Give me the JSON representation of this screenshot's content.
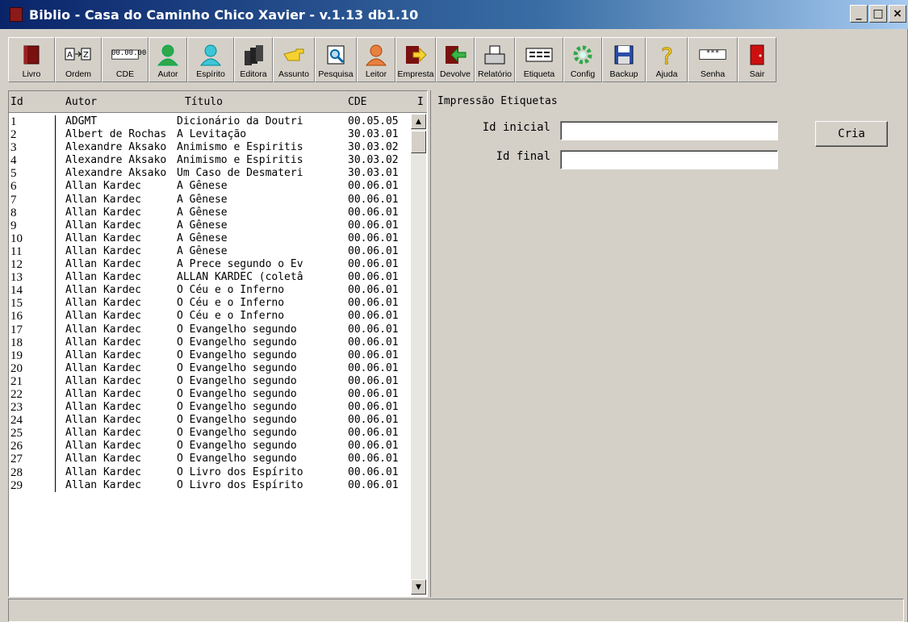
{
  "window": {
    "title": "Biblio - Casa do Caminho Chico Xavier - v.1.13 db1.10",
    "controls": {
      "minimize": "_",
      "maximize": "□",
      "close": "×"
    }
  },
  "toolbar": [
    {
      "label": "Livro",
      "icon": "book-icon",
      "width": 58
    },
    {
      "label": "Ordem",
      "icon": "sort-az-icon",
      "width": 58
    },
    {
      "label": "CDE",
      "icon": "cde-code-icon",
      "width": 58,
      "code": "00.00.00"
    },
    {
      "label": "Autor",
      "icon": "author-person-icon",
      "width": 48
    },
    {
      "label": "Espírito",
      "icon": "spirit-person-icon",
      "width": 58
    },
    {
      "label": "Editora",
      "icon": "books-stack-icon",
      "width": 48
    },
    {
      "label": "Assunto",
      "icon": "pointing-hand-icon",
      "width": 52
    },
    {
      "label": "Pesquisa",
      "icon": "search-icon",
      "width": 52
    },
    {
      "label": "Leitor",
      "icon": "reader-person-icon",
      "width": 48
    },
    {
      "label": "Empresta",
      "icon": "lend-arrow-icon",
      "width": 50
    },
    {
      "label": "Devolve",
      "icon": "return-arrow-icon",
      "width": 48
    },
    {
      "label": "Relatório",
      "icon": "printer-icon",
      "width": 50
    },
    {
      "label": "Etiqueta",
      "icon": "label-icon",
      "width": 60
    },
    {
      "label": "Config",
      "icon": "gear-icon",
      "width": 48
    },
    {
      "label": "Backup",
      "icon": "floppy-disk-icon",
      "width": 54
    },
    {
      "label": "Ajuda",
      "icon": "help-icon",
      "width": 52
    },
    {
      "label": "Senha",
      "icon": "password-icon",
      "width": 62,
      "code": "***"
    },
    {
      "label": "Sair",
      "icon": "exit-door-icon",
      "width": 48
    }
  ],
  "list": {
    "columns": [
      "Id",
      "Autor",
      "Título",
      "CDE",
      "I"
    ],
    "rows": [
      {
        "id": "1",
        "autor": "ADGMT",
        "titulo": "Dicionário da Doutri",
        "cde": "00.05.05"
      },
      {
        "id": "2",
        "autor": "Albert de Rochas",
        "titulo": "A Levitação",
        "cde": "30.03.01"
      },
      {
        "id": "3",
        "autor": "Alexandre Aksako",
        "titulo": "Animismo e Espiritis",
        "cde": "30.03.02"
      },
      {
        "id": "4",
        "autor": "Alexandre Aksako",
        "titulo": "Animismo e Espiritis",
        "cde": "30.03.02"
      },
      {
        "id": "5",
        "autor": "Alexandre Aksako",
        "titulo": "Um Caso de Desmateri",
        "cde": "30.03.01"
      },
      {
        "id": "6",
        "autor": "Allan Kardec",
        "titulo": "A Gênese",
        "cde": "00.06.01"
      },
      {
        "id": "7",
        "autor": "Allan Kardec",
        "titulo": "A Gênese",
        "cde": "00.06.01"
      },
      {
        "id": "8",
        "autor": "Allan Kardec",
        "titulo": "A Gênese",
        "cde": "00.06.01"
      },
      {
        "id": "9",
        "autor": "Allan Kardec",
        "titulo": "A Gênese",
        "cde": "00.06.01"
      },
      {
        "id": "10",
        "autor": "Allan Kardec",
        "titulo": "A Gênese",
        "cde": "00.06.01"
      },
      {
        "id": "11",
        "autor": "Allan Kardec",
        "titulo": "A Gênese",
        "cde": "00.06.01"
      },
      {
        "id": "12",
        "autor": "Allan Kardec",
        "titulo": "A Prece segundo o Ev",
        "cde": "00.06.01"
      },
      {
        "id": "13",
        "autor": "Allan Kardec",
        "titulo": "ALLAN KARDEC (coletâ",
        "cde": "00.06.01"
      },
      {
        "id": "14",
        "autor": "Allan Kardec",
        "titulo": "O Céu e o Inferno",
        "cde": "00.06.01"
      },
      {
        "id": "15",
        "autor": "Allan Kardec",
        "titulo": "O Céu e o Inferno",
        "cde": "00.06.01"
      },
      {
        "id": "16",
        "autor": "Allan Kardec",
        "titulo": "O Céu e o Inferno",
        "cde": "00.06.01"
      },
      {
        "id": "17",
        "autor": "Allan Kardec",
        "titulo": "O Evangelho segundo",
        "cde": "00.06.01"
      },
      {
        "id": "18",
        "autor": "Allan Kardec",
        "titulo": "O Evangelho segundo",
        "cde": "00.06.01"
      },
      {
        "id": "19",
        "autor": "Allan Kardec",
        "titulo": "O Evangelho segundo",
        "cde": "00.06.01"
      },
      {
        "id": "20",
        "autor": "Allan Kardec",
        "titulo": "O Evangelho segundo",
        "cde": "00.06.01"
      },
      {
        "id": "21",
        "autor": "Allan Kardec",
        "titulo": "O Evangelho segundo",
        "cde": "00.06.01"
      },
      {
        "id": "22",
        "autor": "Allan Kardec",
        "titulo": "O Evangelho segundo",
        "cde": "00.06.01"
      },
      {
        "id": "23",
        "autor": "Allan Kardec",
        "titulo": "O Evangelho segundo",
        "cde": "00.06.01"
      },
      {
        "id": "24",
        "autor": "Allan Kardec",
        "titulo": "O Evangelho segundo",
        "cde": "00.06.01"
      },
      {
        "id": "25",
        "autor": "Allan Kardec",
        "titulo": "O Evangelho segundo",
        "cde": "00.06.01"
      },
      {
        "id": "26",
        "autor": "Allan Kardec",
        "titulo": "O Evangelho segundo",
        "cde": "00.06.01"
      },
      {
        "id": "27",
        "autor": "Allan Kardec",
        "titulo": "O Evangelho segundo",
        "cde": "00.06.01"
      },
      {
        "id": "28",
        "autor": "Allan Kardec",
        "titulo": "O Livro dos Espírito",
        "cde": "00.06.01"
      },
      {
        "id": "29",
        "autor": "Allan Kardec",
        "titulo": "O Livro dos Espírito",
        "cde": "00.06.01"
      }
    ]
  },
  "panel": {
    "title": "Impressão Etiquetas",
    "id_inicial_label": "Id inicial",
    "id_inicial_value": "",
    "id_final_label": "Id final",
    "id_final_value": "",
    "cria_label": "Cria"
  },
  "status": {
    "text": ""
  }
}
